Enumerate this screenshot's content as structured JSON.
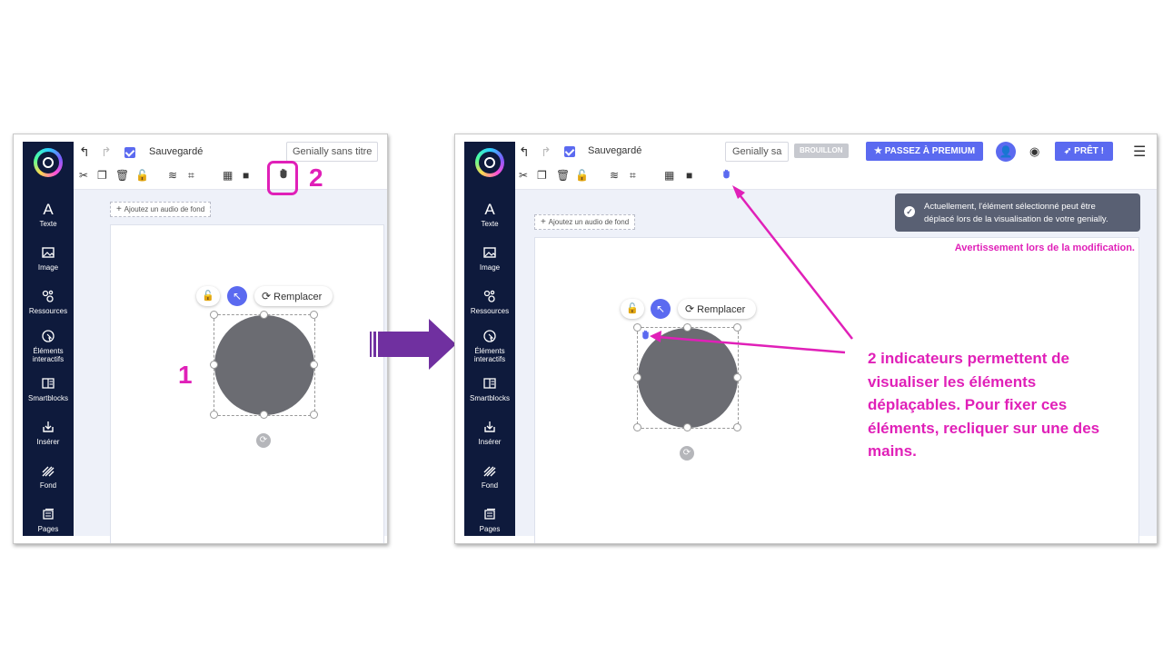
{
  "colors": {
    "accent": "#e020b8",
    "brand_blue": "#5b6af0",
    "sidebar": "#0e1a3c",
    "arrow": "#7030a0"
  },
  "sidebar_items": [
    {
      "label": "Texte",
      "icon": "text-icon"
    },
    {
      "label": "Image",
      "icon": "image-icon"
    },
    {
      "label": "Ressources",
      "icon": "resources-icon"
    },
    {
      "label_line1": "Éléments",
      "label_line2": "interactifs",
      "icon": "interactive-icon"
    },
    {
      "label": "Smartblocks",
      "icon": "smartblocks-icon"
    },
    {
      "label": "Insérer",
      "icon": "insert-icon"
    },
    {
      "label": "Fond",
      "icon": "background-icon"
    },
    {
      "label": "Pages",
      "icon": "pages-icon"
    }
  ],
  "topbar": {
    "saved_label": "Sauvegardé",
    "title_left": "Genially sans titre",
    "title_right": "Genially sa",
    "draft_badge": "BROUILLON",
    "premium_label": "PASSEZ À PREMIUM",
    "ready_label": "PRÊT !"
  },
  "canvas": {
    "audio_label": "Ajoutez un audio de fond",
    "replace_label": "Remplacer"
  },
  "callouts": {
    "step1": "1",
    "step2": "2",
    "toast_line1": "Actuellement, l'élément sélectionné peut être",
    "toast_line2": "déplacé lors de la visualisation de votre genially.",
    "warning": "Avertissement lors de la modification.",
    "explain_lines": [
      "2 indicateurs permettent de",
      "visualiser les éléments",
      "déplaçables. Pour fixer ces",
      "éléments, recliquer sur une des",
      "mains."
    ]
  }
}
